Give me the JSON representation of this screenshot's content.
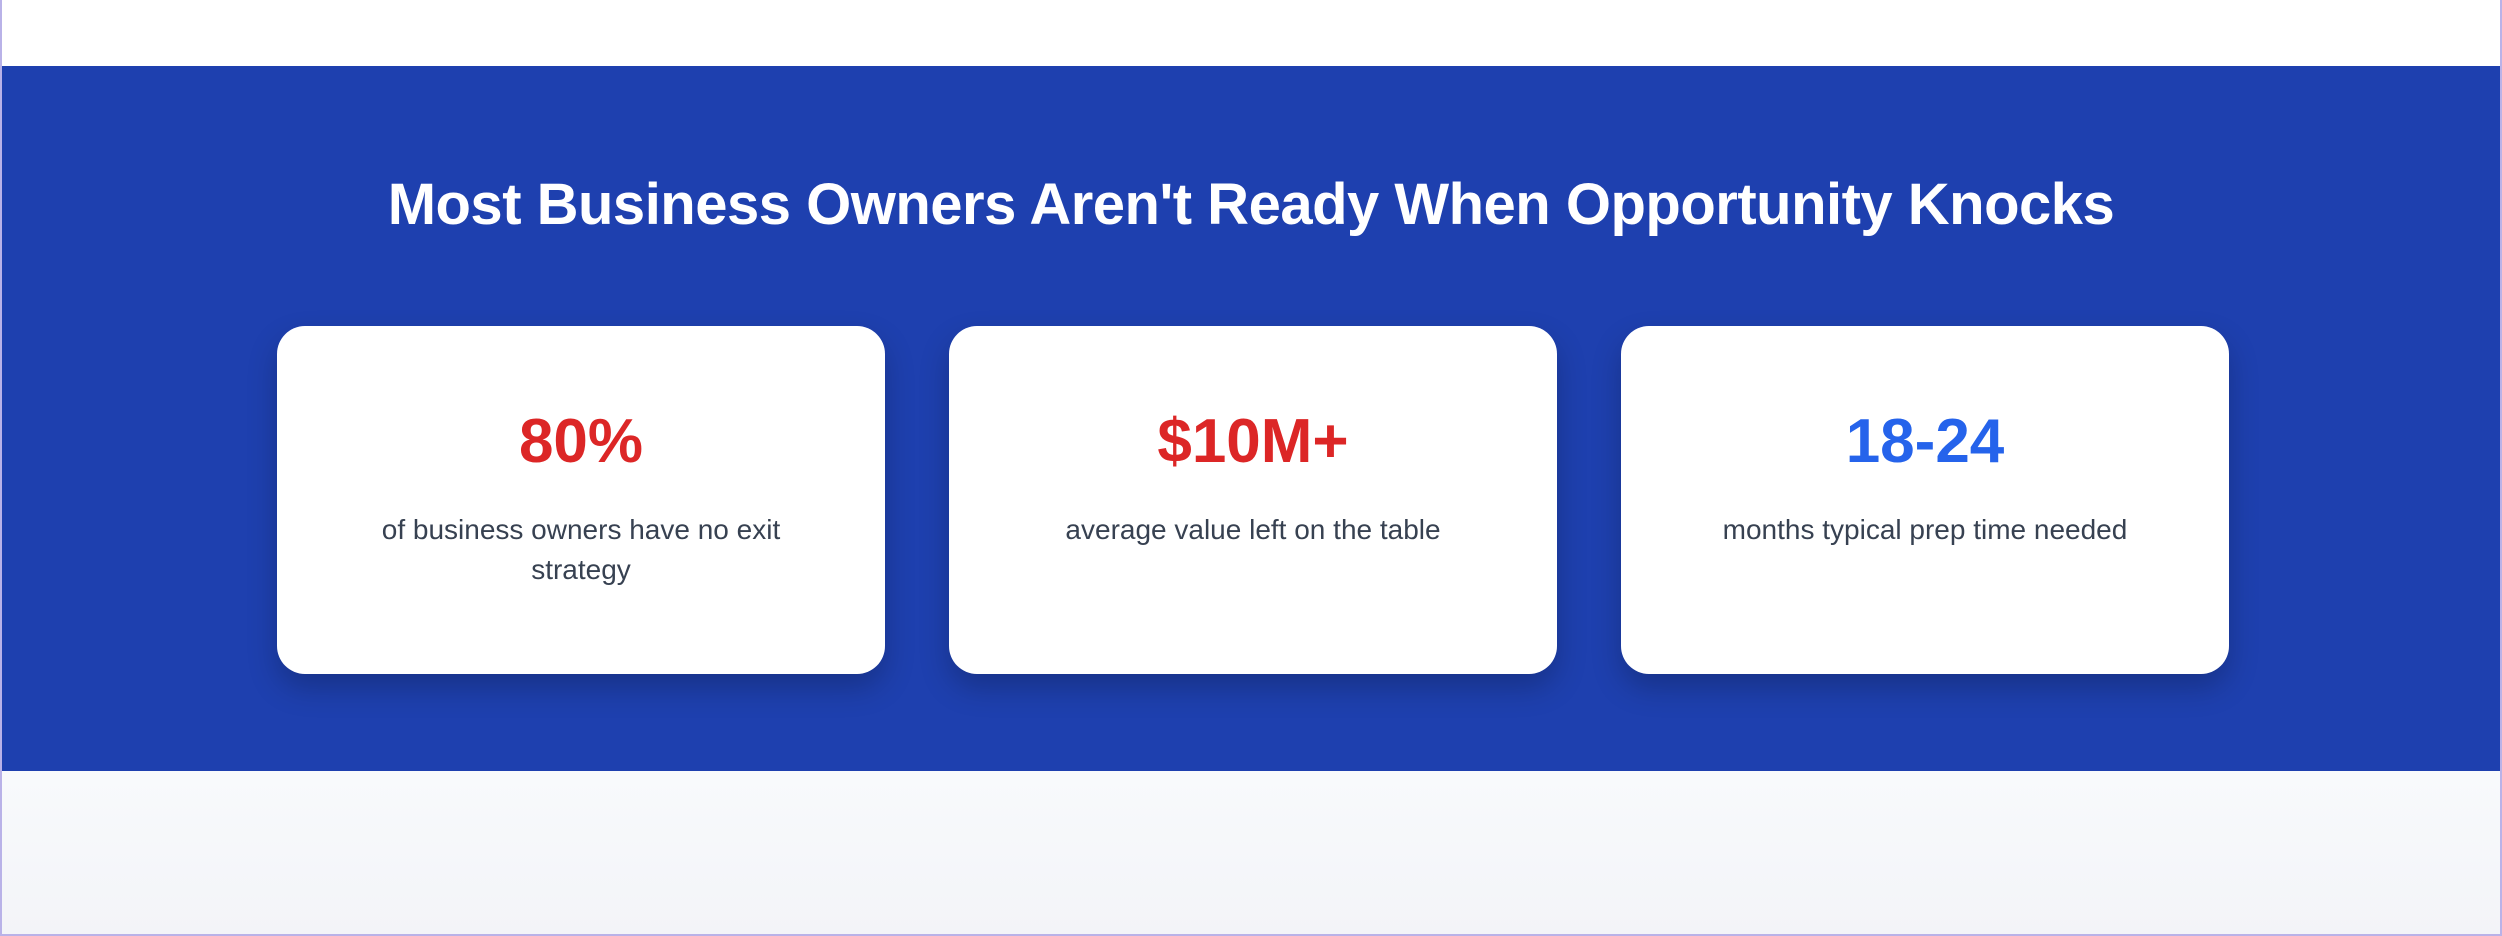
{
  "section": {
    "title": "Most Business Owners Aren't Ready When Opportunity Knocks",
    "background_color": "#1e40af"
  },
  "stats": [
    {
      "value": "80%",
      "label": "of business owners have no exit strategy",
      "value_color": "#dc2626"
    },
    {
      "value": "$10M+",
      "label": "average value left on the table",
      "value_color": "#dc2626"
    },
    {
      "value": "18-24",
      "label": "months typical prep time needed",
      "value_color": "#2563eb"
    }
  ]
}
